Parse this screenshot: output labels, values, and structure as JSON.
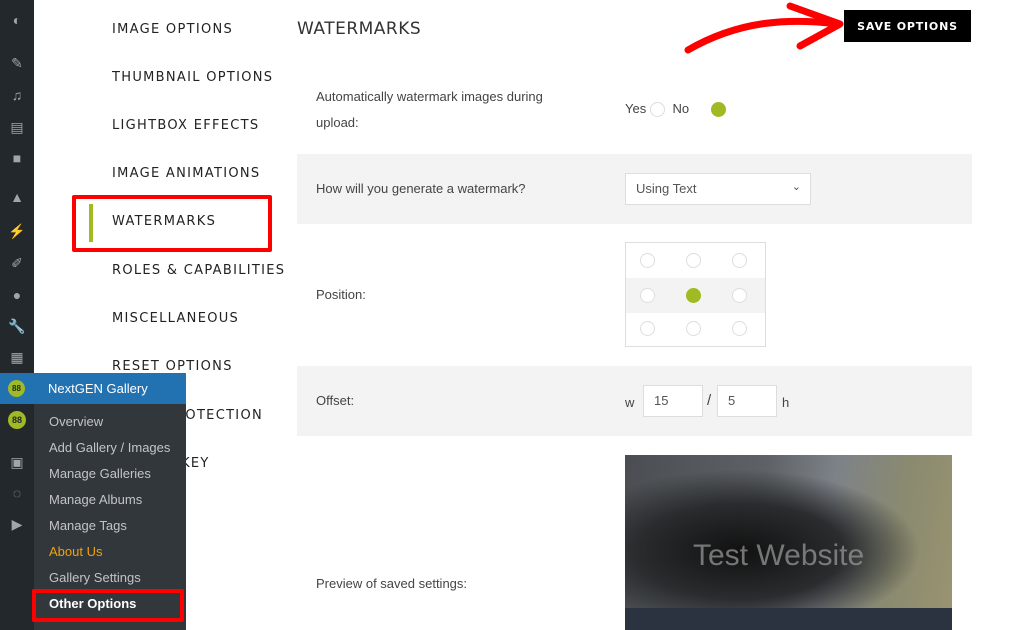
{
  "sidebar_nav": [
    "IMAGE OPTIONS",
    "THUMBNAIL OPTIONS",
    "LIGHTBOX EFFECTS",
    "IMAGE ANIMATIONS",
    "WATERMARKS",
    "ROLES & CAPABILITIES",
    "MISCELLANEOUS",
    "RESET OPTIONS",
    "IMAGE PROTECTION",
    "LICENSE KEY"
  ],
  "active_nav": "WATERMARKS",
  "page_title": "WATERMARKS",
  "save_label": "SAVE OPTIONS",
  "rows": {
    "auto": {
      "label": "Automatically watermark images during upload:",
      "yes": "Yes",
      "no": "No",
      "selected": "No"
    },
    "method": {
      "label": "How will you generate a watermark?",
      "value": "Using Text"
    },
    "position": {
      "label": "Position:",
      "selected": "middle-center"
    },
    "offset": {
      "label": "Offset:",
      "w_label": "w",
      "w": "15",
      "sep": "/",
      "h": "5",
      "h_label": "h"
    },
    "preview": {
      "label": "Preview of saved settings:",
      "watermark_text": "Test Website"
    }
  },
  "flyout": {
    "title": "NextGEN Gallery",
    "items": [
      "Overview",
      "Add Gallery / Images",
      "Manage Galleries",
      "Manage Albums",
      "Manage Tags",
      "About Us",
      "Gallery Settings",
      "Other Options"
    ],
    "highlight": "About Us",
    "current": "Other Options"
  },
  "colors": {
    "accent": "#9fba22",
    "highlight": "#ff0000",
    "menu_blue": "#2271b1",
    "about_orange": "#f0a30a"
  }
}
